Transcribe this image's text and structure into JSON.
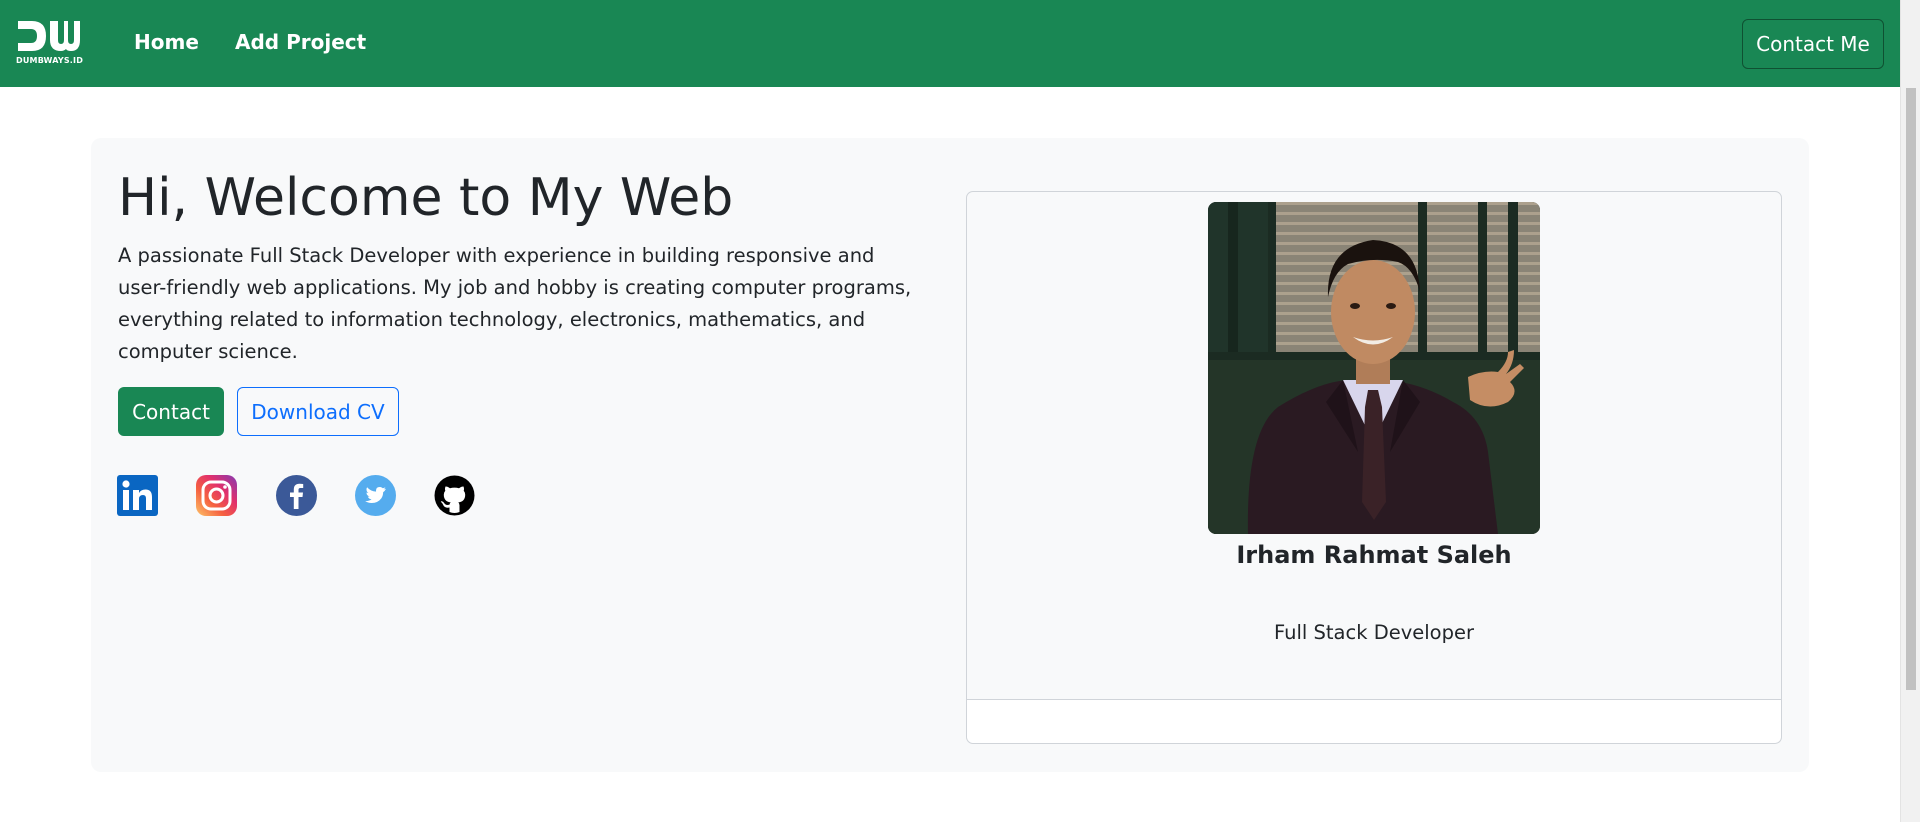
{
  "navbar": {
    "brand_text": "DUMBWAYS.ID",
    "links": [
      {
        "label": "Home"
      },
      {
        "label": "Add Project"
      }
    ],
    "contact_button": "Contact Me",
    "color": "#198754"
  },
  "hero": {
    "title": "Hi, Welcome to My Web",
    "description": "A passionate Full Stack Developer with experience in building responsive and user-friendly web applications. My job and hobby is creating computer programs, everything related to information technology, electronics, mathematics, and computer science.",
    "contact_button": "Contact",
    "cv_button": "Download CV",
    "socials": [
      {
        "icon": "linkedin-icon"
      },
      {
        "icon": "instagram-icon"
      },
      {
        "icon": "facebook-icon"
      },
      {
        "icon": "twitter-icon"
      },
      {
        "icon": "github-icon"
      }
    ]
  },
  "profile": {
    "name": "Irham Rahmat Saleh",
    "role": "Full Stack Developer"
  },
  "colors": {
    "primary_green": "#198754",
    "link_blue": "#0d6efd",
    "panel_bg": "#f8f9fa"
  }
}
